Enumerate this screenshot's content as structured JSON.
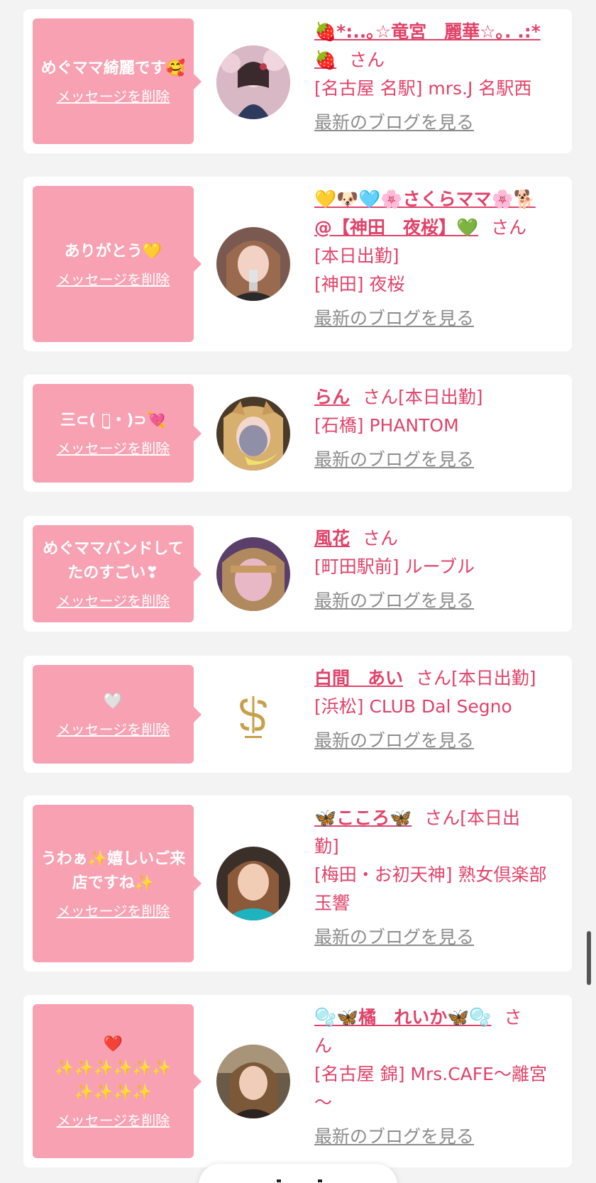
{
  "common": {
    "delete_label": "メッセージを削除",
    "blog_label": "最新のブログを見る",
    "san": "さん"
  },
  "colors": {
    "background": "#f3f3f3",
    "bubble": "#f7a1b3",
    "accent": "#e0436a",
    "blog_link": "#8c8c8c"
  },
  "messages": [
    {
      "text": "めぐママ綺麗です🥰",
      "name_part1": "🍓*:..｡☆竜宮　麗華☆｡. .:*",
      "name_part2": "🍓",
      "shop": "[名古屋 名駅] mrs.J 名駅西",
      "status": "",
      "avatar_icon": "photo-avatar"
    },
    {
      "text": "ありがとう💛",
      "name_part1": "💛🐶🩵🌸さくらママ🌸🐕",
      "name_part2": "@【神田　夜桜】💚",
      "status": "[本日出勤]",
      "shop": "[神田] 夜桜",
      "avatar_icon": "photo-avatar"
    },
    {
      "text": "三⊂( ・̫・)⊃💘",
      "name": "らん",
      "status": "[本日出勤]",
      "shop": "[石橋] PHANTOM",
      "avatar_icon": "photo-avatar"
    },
    {
      "text": "めぐママバンドしてたのすごい❣",
      "name": "風花",
      "status": "",
      "shop": "[町田駅前] ルーブル",
      "avatar_icon": "photo-avatar"
    },
    {
      "text": "🤍",
      "name": "白間　あい",
      "status": "[本日出勤]",
      "shop": "[浜松] CLUB Dal Segno",
      "avatar_icon": "club-logo"
    },
    {
      "text": "うわぁ✨嬉しいご来店ですね✨",
      "name": "🦋こころ🦋",
      "status_part1": "[本日出",
      "status_part2": "勤]",
      "shop_part1": "[梅田・お初天神] 熟女倶楽部",
      "shop_part2": "玉響",
      "avatar_icon": "photo-avatar"
    },
    {
      "text_line1": "❤️",
      "text_line2": "✨✨✨✨✨✨",
      "text_line3": "✨✨✨✨",
      "name": "🫧🦋橘　れいか🦋🫧",
      "san_part1": "さ",
      "san_part2": "ん",
      "shop_part1": "[名古屋 錦] Mrs.CAFE〜離宮",
      "shop_part2": "〜",
      "avatar_icon": "photo-avatar"
    }
  ]
}
